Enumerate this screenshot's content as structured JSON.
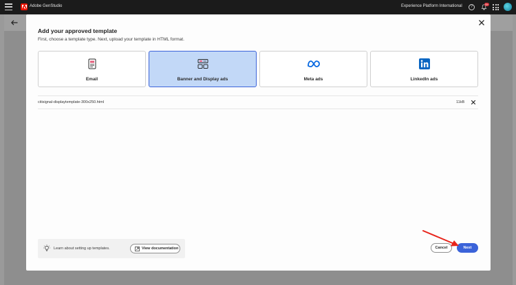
{
  "topbar": {
    "app_name": "Adobe GenStudio",
    "org_name": "Experience Platform International",
    "notification_count": "9+",
    "help_glyph": "?"
  },
  "modal": {
    "title": "Add your approved template",
    "subtitle": "First, choose a template type. Next, upload your template in HTML format.",
    "template_types": [
      {
        "label": "Email",
        "icon": "email-template-icon",
        "selected": false
      },
      {
        "label": "Banner and Display ads",
        "icon": "banner-display-icon",
        "selected": true
      },
      {
        "label": "Meta ads",
        "icon": "meta-logo-icon",
        "selected": false
      },
      {
        "label": "LinkedIn ads",
        "icon": "linkedin-logo-icon",
        "selected": false
      }
    ],
    "file": {
      "name": "citisignal-displaytemplate-300x250.html",
      "size": "11kB"
    },
    "help": {
      "text": "Learn about setting up templates.",
      "doc_button": "View documentation"
    },
    "cancel_label": "Cancel",
    "next_label": "Next"
  },
  "colors": {
    "accent": "#3b63d9",
    "selected_card_bg": "#c2d8f7",
    "topbar_bg": "#1b1b1b",
    "annotation_arrow": "#e8251c",
    "adobe_red": "#eb1000",
    "linkedin_blue": "#0a66c2",
    "meta_blue": "#0668e1"
  }
}
